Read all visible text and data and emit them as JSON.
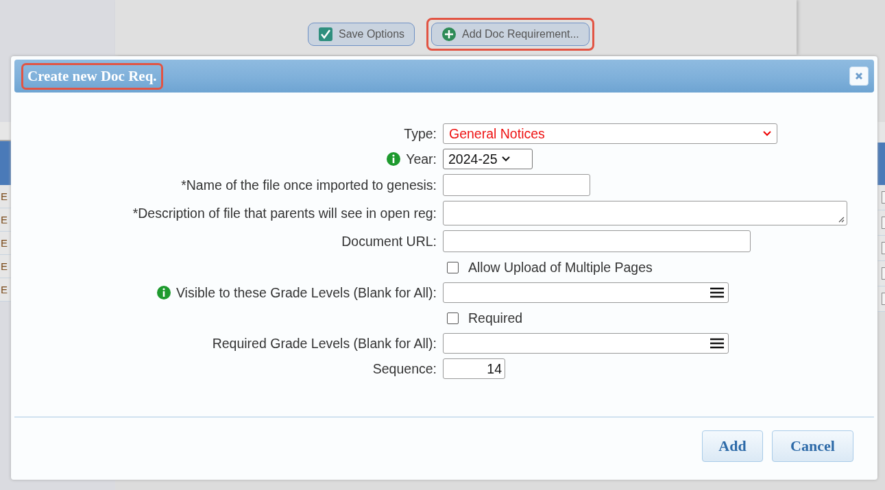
{
  "background": {
    "buttons": [
      {
        "label": "Save Options",
        "highlighted": false
      },
      {
        "label": "Add Doc Requirement...",
        "highlighted": true
      }
    ],
    "left_table": {
      "rows": [
        "E",
        "E",
        "E",
        "E",
        "E"
      ]
    },
    "right_table": {
      "rows": [
        {
          "checked": false
        },
        {
          "checked": false
        },
        {
          "checked": false
        },
        {
          "checked": false
        },
        {
          "checked": false
        }
      ]
    }
  },
  "dialog": {
    "title": "Create new Doc Req.",
    "title_highlighted": true,
    "fields": [
      {
        "kind": "select",
        "label": "Type:",
        "info": false,
        "value": "General Notices"
      },
      {
        "kind": "year",
        "label": "Year:",
        "info": true,
        "value": "2024-25"
      },
      {
        "kind": "text",
        "label": "*Name of the file once imported to genesis:",
        "info": false
      },
      {
        "kind": "textarea",
        "label": "*Description of file that parents will see in open reg:",
        "info": false
      },
      {
        "kind": "url",
        "label": "Document URL:",
        "info": false
      },
      {
        "kind": "checkbox",
        "label": "Allow Upload of Multiple Pages",
        "checked": false
      },
      {
        "kind": "multi",
        "label": "Visible to these Grade Levels (Blank for All):",
        "info": true
      },
      {
        "kind": "checkbox",
        "label": "Required",
        "checked": false
      },
      {
        "kind": "multi",
        "label": "Required Grade Levels (Blank for All):",
        "info": false
      },
      {
        "kind": "number",
        "label": "Sequence:",
        "info": false,
        "value": "14"
      }
    ],
    "buttons": [
      "Add",
      "Cancel"
    ]
  }
}
